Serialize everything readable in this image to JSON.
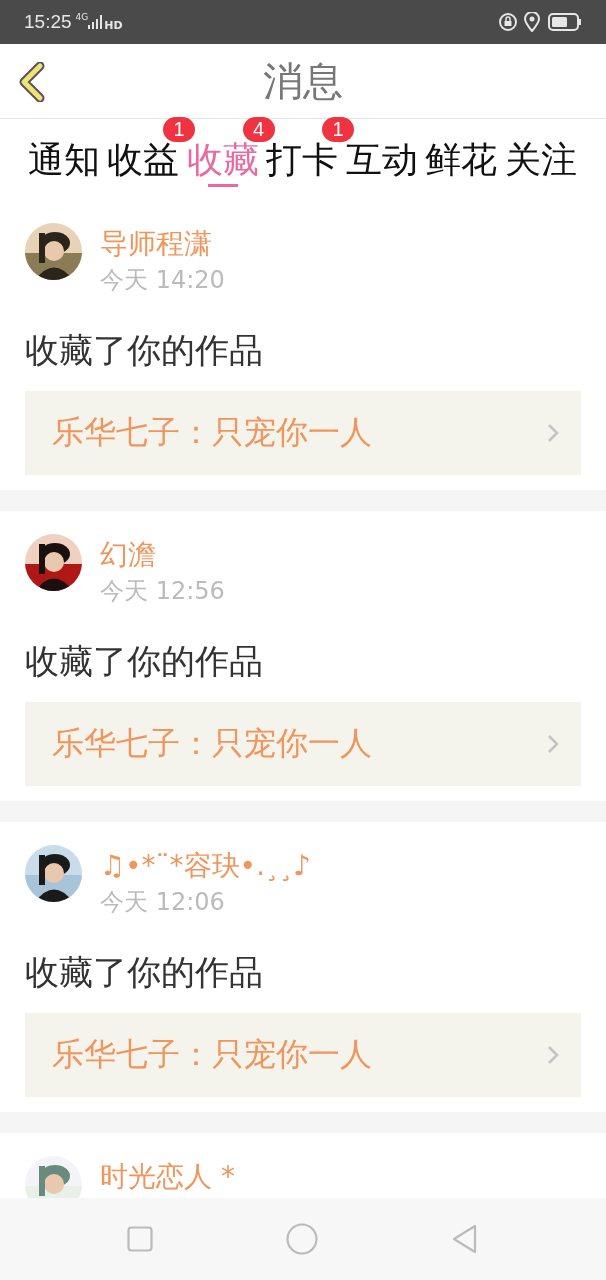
{
  "status_bar": {
    "time": "15:25",
    "network": "4G",
    "hd": "HD"
  },
  "header": {
    "title": "消息"
  },
  "tabs": [
    {
      "label": "通知",
      "selected": false
    },
    {
      "label": "收益",
      "selected": false,
      "badge": "1"
    },
    {
      "label": "收藏",
      "selected": true,
      "badge": "4"
    },
    {
      "label": "打卡",
      "selected": false,
      "badge": "1"
    },
    {
      "label": "互动",
      "selected": false
    },
    {
      "label": "鲜花",
      "selected": false
    },
    {
      "label": "关注",
      "selected": false
    }
  ],
  "messages": [
    {
      "name": "导师程潇",
      "time": "今天 14:20",
      "text": "收藏了你的作品",
      "work": "乐华七子：只宠你一人"
    },
    {
      "name": "幻澹",
      "time": "今天 12:56",
      "text": "收藏了你的作品",
      "work": "乐华七子：只宠你一人"
    },
    {
      "name": "♫•*¨*容玦•.¸¸♪",
      "time": "今天 12:06",
      "text": "收藏了你的作品",
      "work": "乐华七子：只宠你一人"
    },
    {
      "name": "时光恋人 *"
    }
  ]
}
